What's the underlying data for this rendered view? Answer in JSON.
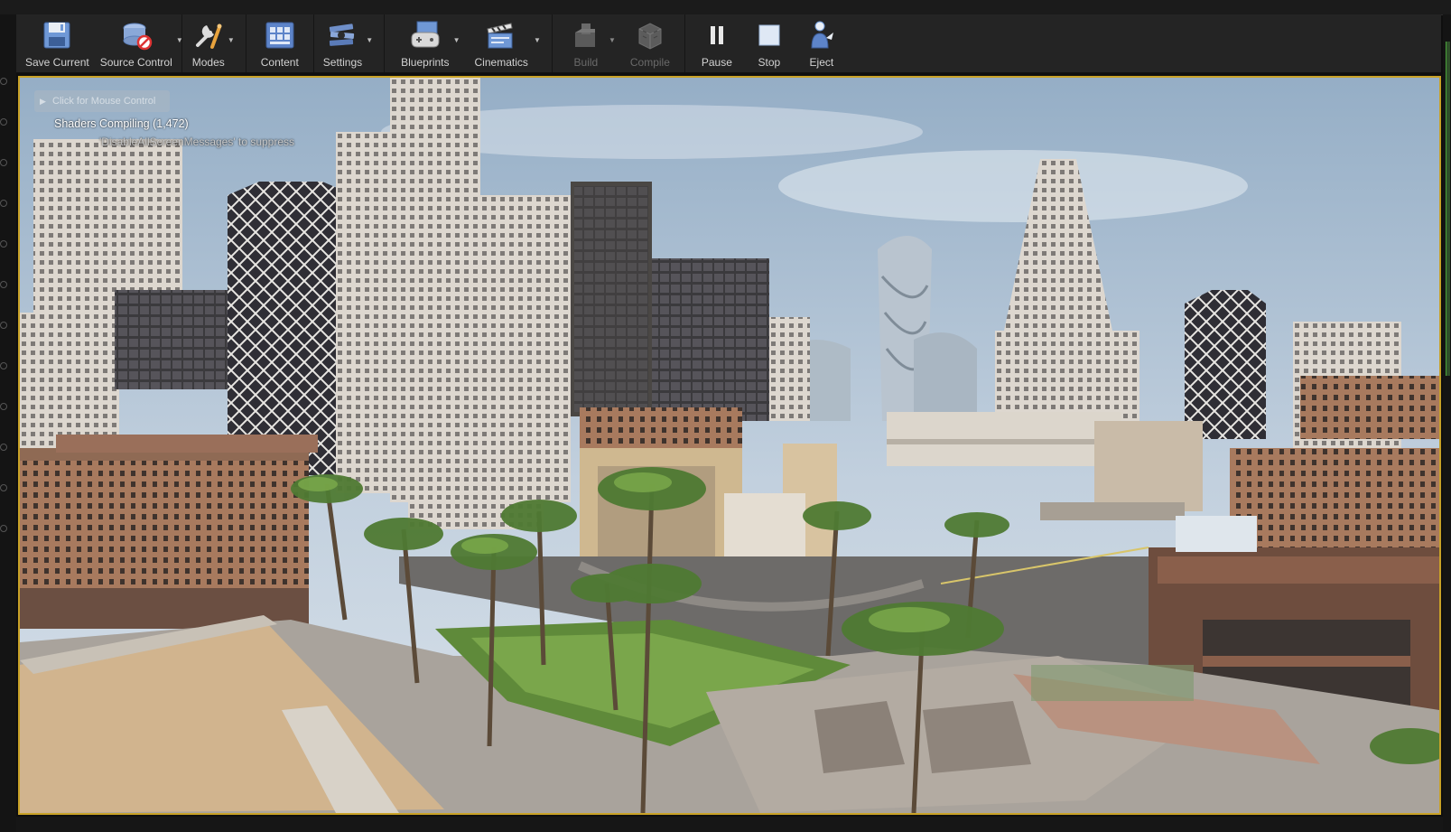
{
  "toolbar": {
    "buttons": [
      {
        "label": "Save Current",
        "icon": "save-icon"
      },
      {
        "label": "Source Control",
        "icon": "source-control-icon"
      },
      {
        "label": "Modes",
        "icon": "modes-icon"
      },
      {
        "label": "Content",
        "icon": "content-icon"
      },
      {
        "label": "Settings",
        "icon": "settings-icon"
      },
      {
        "label": "Blueprints",
        "icon": "blueprints-icon"
      },
      {
        "label": "Cinematics",
        "icon": "cinematics-icon"
      },
      {
        "label": "Build",
        "icon": "build-icon"
      },
      {
        "label": "Compile",
        "icon": "compile-icon"
      },
      {
        "label": "Pause",
        "icon": "pause-icon"
      },
      {
        "label": "Stop",
        "icon": "stop-icon"
      },
      {
        "label": "Eject",
        "icon": "eject-icon"
      }
    ]
  },
  "viewport": {
    "mouse_control_label": "Click for Mouse Control",
    "shaders_message": "Shaders Compiling (1,472)",
    "suppress_message": "'DisableAllScreenMessages' to suppress",
    "border_color": "#c9a227"
  },
  "colors": {
    "accent": "#c9a227",
    "toolbar_bg": "#242424",
    "sky": "#a9bfd3"
  }
}
